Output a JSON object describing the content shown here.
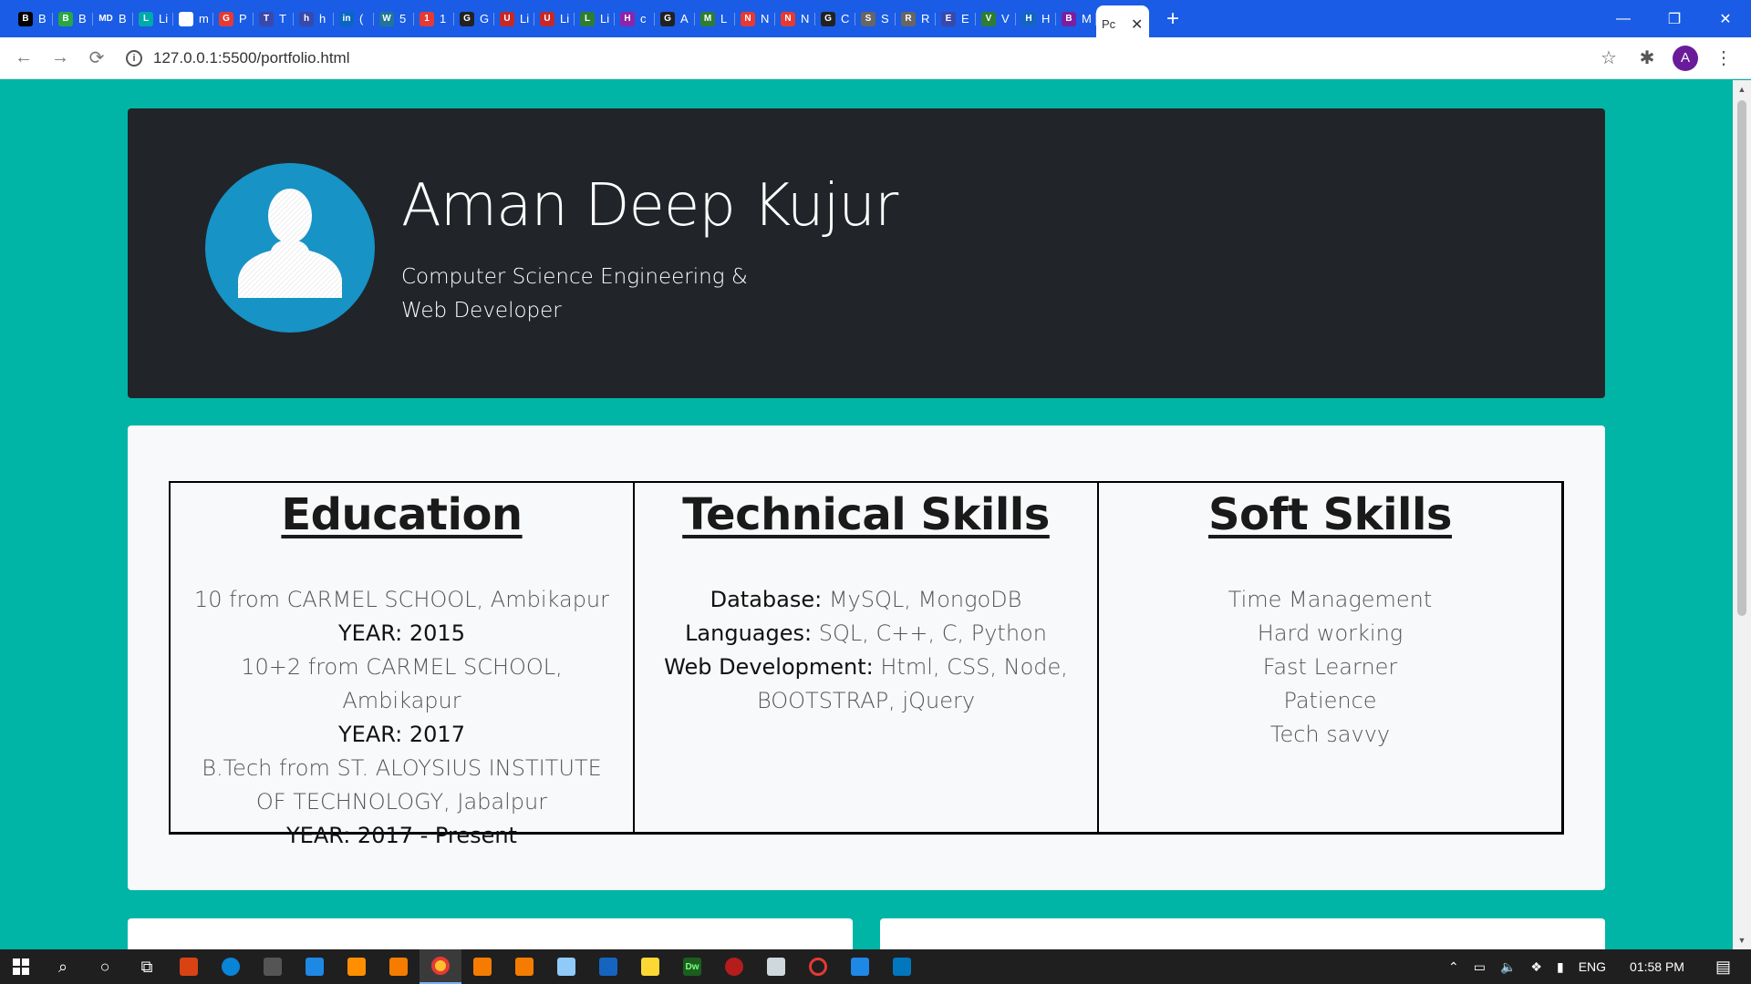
{
  "browser": {
    "tabs": [
      {
        "icon": "B",
        "label": "B",
        "color": "#000000"
      },
      {
        "icon": "B",
        "label": "B",
        "color": "#28a745"
      },
      {
        "icon": "MD",
        "label": "B",
        "color": "#1a5ce5"
      },
      {
        "icon": "L",
        "label": "Li",
        "color": "#0aa"
      },
      {
        "icon": "G",
        "label": "m",
        "color": "#ffffff"
      },
      {
        "icon": "G",
        "label": "P",
        "color": "#e53935"
      },
      {
        "icon": "T",
        "label": "T",
        "color": "#3949ab"
      },
      {
        "icon": "h",
        "label": "h",
        "color": "#3949ab"
      },
      {
        "icon": "in",
        "label": "(",
        "color": "#0a66c2"
      },
      {
        "icon": "W",
        "label": "5",
        "color": "#21759b"
      },
      {
        "icon": "1",
        "label": "1",
        "color": "#e53935"
      },
      {
        "icon": "G",
        "label": "G",
        "color": "#222222"
      },
      {
        "icon": "U",
        "label": "Li",
        "color": "#c62828"
      },
      {
        "icon": "U",
        "label": "Li",
        "color": "#c62828"
      },
      {
        "icon": "L",
        "label": "Li",
        "color": "#2e7d32"
      },
      {
        "icon": "H",
        "label": "c",
        "color": "#8e24aa"
      },
      {
        "icon": "G",
        "label": "A",
        "color": "#222222"
      },
      {
        "icon": "M",
        "label": "L",
        "color": "#2e7d32"
      },
      {
        "icon": "N",
        "label": "N",
        "color": "#e53935"
      },
      {
        "icon": "N",
        "label": "N",
        "color": "#e53935"
      },
      {
        "icon": "G",
        "label": "C",
        "color": "#222222"
      },
      {
        "icon": "S",
        "label": "S",
        "color": "#666666"
      },
      {
        "icon": "R",
        "label": "R",
        "color": "#666666"
      },
      {
        "icon": "E",
        "label": "E",
        "color": "#3949ab"
      },
      {
        "icon": "V",
        "label": "V",
        "color": "#2e7d32"
      },
      {
        "icon": "H",
        "label": "H",
        "color": "#1565c0"
      },
      {
        "icon": "B",
        "label": "M",
        "color": "#7b1fa2"
      }
    ],
    "active_tab": {
      "label": "Pc"
    },
    "address": "127.0.0.1:5500/portfolio.html",
    "profile_initial": "A"
  },
  "hero": {
    "name": "Aman Deep Kujur",
    "subtitle": "Computer Science Engineering & Web Developer"
  },
  "sections": {
    "education": {
      "title": "Education",
      "lines": [
        {
          "text": "10 from CARMEL SCHOOL, Ambikapur",
          "strong": false
        },
        {
          "text": "YEAR: 2015",
          "strong": true
        },
        {
          "text": "10+2 from CARMEL SCHOOL, Ambikapur",
          "strong": false
        },
        {
          "text": "YEAR: 2017",
          "strong": true
        },
        {
          "text": "B.Tech from ST. ALOYSIUS INSTITUTE OF TECHNOLOGY, Jabalpur",
          "strong": false
        },
        {
          "text": "YEAR: 2017 - Present",
          "strong": true
        }
      ]
    },
    "technical": {
      "title": "Technical Skills",
      "items": [
        {
          "label": "Database:",
          "value": " MySQL, MongoDB"
        },
        {
          "label": "Languages:",
          "value": " SQL, C++, C, Python"
        },
        {
          "label": "Web Development:",
          "value": " Html, CSS, Node, BOOTSTRAP, jQuery"
        }
      ]
    },
    "soft": {
      "title": "Soft Skills",
      "items": [
        "Time Management",
        "Hard working",
        "Fast Learner",
        "Patience",
        "Tech savvy"
      ]
    }
  },
  "taskbar": {
    "language": "ENG",
    "time": "01:58 PM"
  },
  "colors": {
    "page_bg": "#00b5a6",
    "hero_bg": "#212529",
    "avatar_bg": "#1793c6",
    "tabstrip": "#1a5ce5"
  }
}
